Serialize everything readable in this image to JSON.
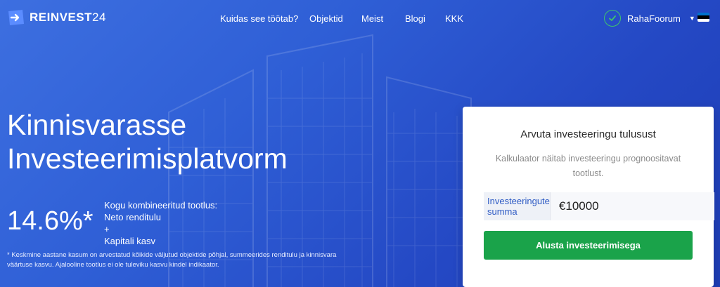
{
  "brand": {
    "name_bold": "REINVEST",
    "name_light": "24"
  },
  "nav": [
    {
      "label": "Kuidas see töötab?"
    },
    {
      "label": "Objektid"
    },
    {
      "label": "Meist"
    },
    {
      "label": "Blogi"
    },
    {
      "label": "KKK"
    }
  ],
  "header": {
    "forum_label": "RahaFoorum",
    "flag_colors": [
      "#0072ce",
      "#000000",
      "#ffffff"
    ]
  },
  "hero": {
    "title_line1": "Kinnisvarasse",
    "title_line2": "Investeerimisplatvorm",
    "stat_value": "14.6%*",
    "stat_line1": "Kogu kombineeritud tootlus:",
    "stat_line2": "Neto renditulu",
    "stat_line3": "+",
    "stat_line4": "Kapitali kasv",
    "footnote": "* Keskmine aastane kasum on arvestatud kõikide väljutud objektide põhjal, summeerides renditulu ja kinnisvara väärtuse kasvu. Ajalooline tootlus ei ole tuleviku kasvu kindel indikaator."
  },
  "calculator": {
    "title": "Arvuta investeeringu tulusust",
    "subtitle": "Kalkulaator näitab investeeringu prognoositavat tootlust.",
    "amount_label": "Investeeringute summa",
    "amount_value": "€10000",
    "cta_label": "Alusta investeerimisega"
  },
  "colors": {
    "primary_blue": "#2f5fd6",
    "accent_green": "#1aa34a",
    "check_green": "#3fc46c"
  }
}
